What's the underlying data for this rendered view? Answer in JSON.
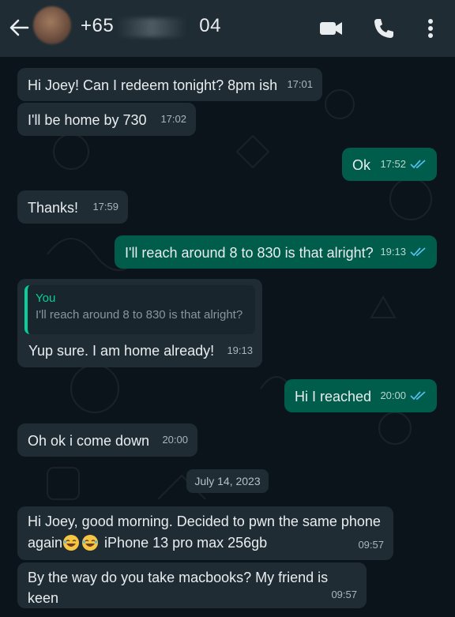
{
  "header": {
    "contact_prefix": "+65",
    "contact_suffix": "04"
  },
  "colors": {
    "incoming_bubble": "#1f2c34",
    "outgoing_bubble": "#005c4b",
    "chat_background": "#0b141a",
    "read_ticks": "#53bdeb",
    "quote_accent": "#06cf9c"
  },
  "icons": [
    "back-arrow-icon",
    "video-call-icon",
    "voice-call-icon",
    "more-options-icon",
    "double-check-icon",
    "laughing-emoji-icon"
  ],
  "messages": [
    {
      "direction": "in",
      "text": "Hi Joey! Can I redeem tonight? 8pm ish",
      "time": "17:01"
    },
    {
      "direction": "in",
      "text": "I'll be home by 730",
      "time": "17:02"
    },
    {
      "direction": "out",
      "text": "Ok",
      "time": "17:52",
      "status": "read"
    },
    {
      "direction": "in",
      "text": "Thanks!",
      "time": "17:59"
    },
    {
      "direction": "out",
      "text": "I'll reach around 8 to 830 is that alright?",
      "time": "19:13",
      "status": "read"
    },
    {
      "direction": "in",
      "quote_author": "You",
      "quote_text": "I'll reach around 8 to 830 is that alright?",
      "text": "Yup sure. I am home already!",
      "time": "19:13"
    },
    {
      "direction": "out",
      "text": "Hi I reached",
      "time": "20:00",
      "status": "read"
    },
    {
      "direction": "in",
      "text": "Oh ok i come down",
      "time": "20:00"
    },
    {
      "direction": "in",
      "line1": "Hi Joey, good morning. Decided to pwn the same phone",
      "line2_start": "again",
      "line2_end": " iPhone 13 pro max 256gb",
      "time": "09:57"
    },
    {
      "direction": "in",
      "text": "By the way do you take macbooks? My friend is keen",
      "time": "09:57"
    }
  ],
  "date_separator": "July 14, 2023"
}
